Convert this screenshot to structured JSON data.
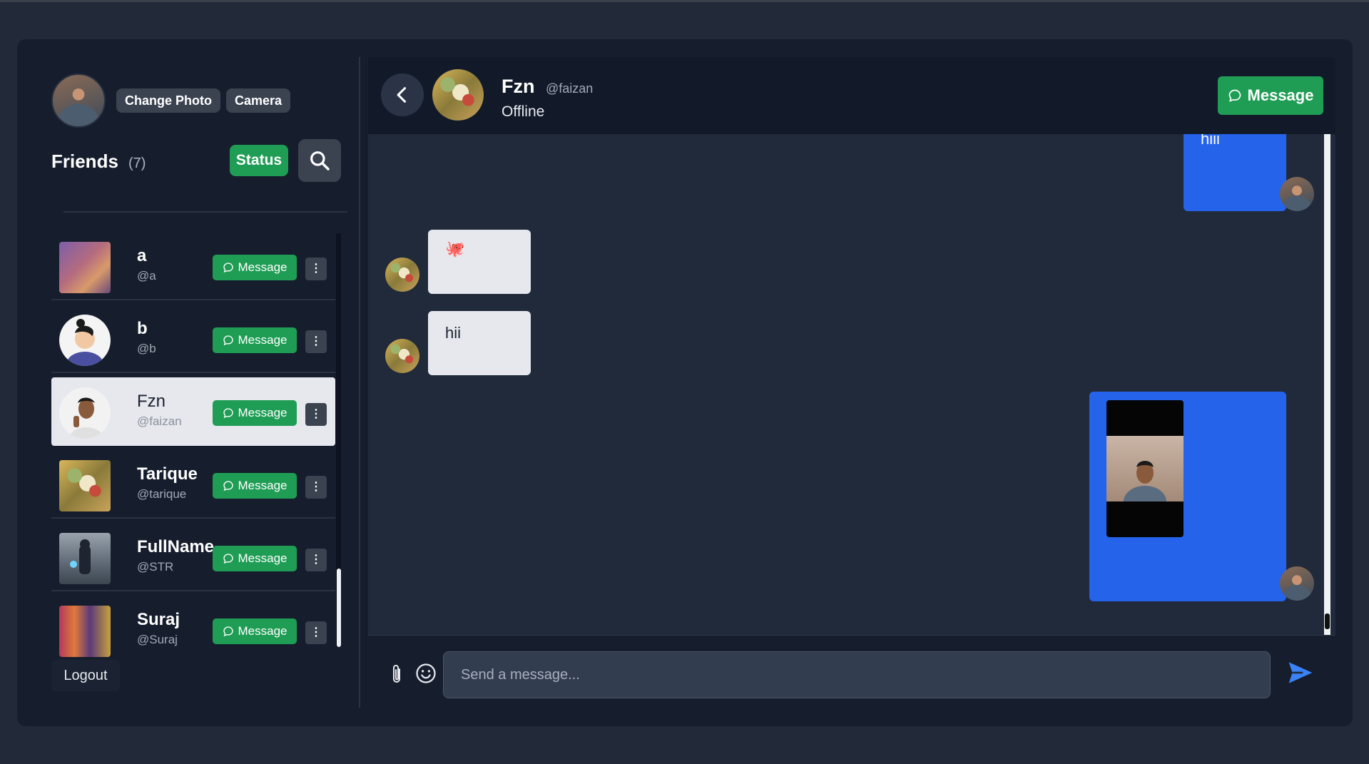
{
  "profile": {
    "change_photo_label": "Change Photo",
    "camera_label": "Camera"
  },
  "friends": {
    "title": "Friends",
    "count": "(7)",
    "status_label": "Status",
    "message_label": "Message",
    "more_label": "⋮",
    "items": [
      {
        "name": "a",
        "username": "@a"
      },
      {
        "name": "b",
        "username": "@b"
      },
      {
        "name": "Fzn",
        "username": "@faizan"
      },
      {
        "name": "Tarique",
        "username": "@tarique"
      },
      {
        "name": "FullName",
        "username": "@STR"
      },
      {
        "name": "Suraj",
        "username": "@Suraj"
      }
    ]
  },
  "logout_label": "Logout",
  "chat": {
    "name": "Fzn",
    "username": "@faizan",
    "status": "Offline",
    "message_button_label": "Message",
    "messages": [
      {
        "direction": "out",
        "type": "text",
        "text": "hiii"
      },
      {
        "direction": "in",
        "type": "emoji",
        "text": "🐙"
      },
      {
        "direction": "in",
        "type": "text",
        "text": "hii"
      },
      {
        "direction": "out",
        "type": "video",
        "text": ""
      }
    ],
    "input_placeholder": "Send a message..."
  },
  "colors": {
    "accent_green": "#1f9d55",
    "outgoing_bubble": "#2563eb",
    "incoming_bubble": "#e6e8ee",
    "background": "#222a3a"
  },
  "icons": [
    "search-icon",
    "chevron-left-icon",
    "chat-bubble-icon",
    "paperclip-icon",
    "emoji-icon",
    "send-icon",
    "kebab-icon"
  ]
}
